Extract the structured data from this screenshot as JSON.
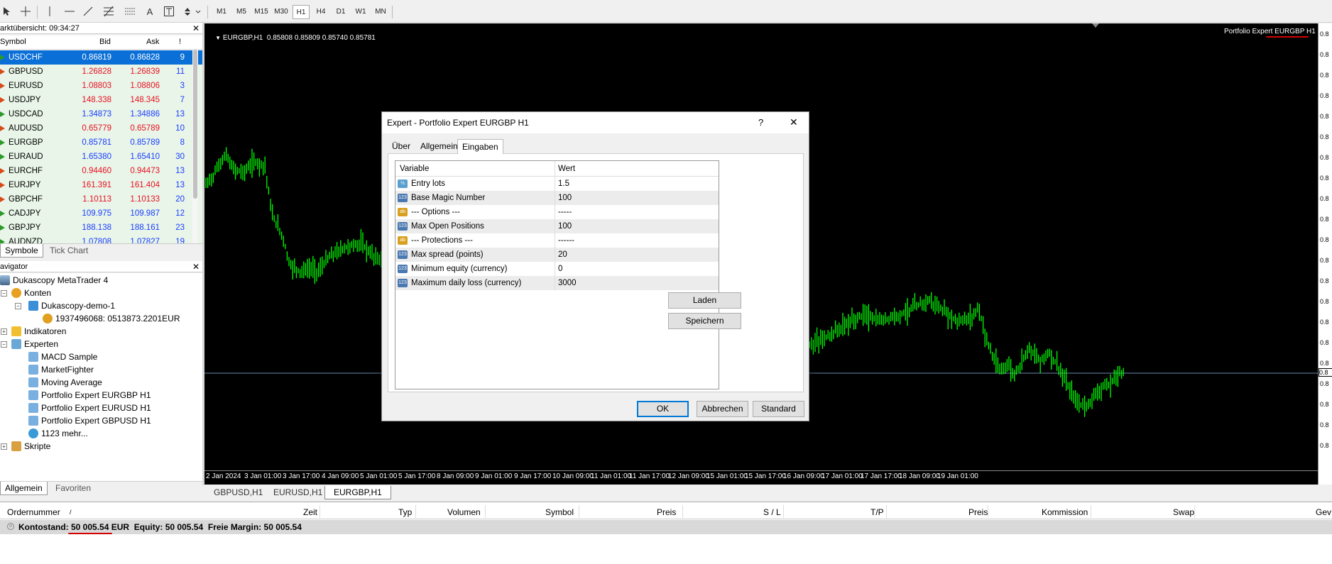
{
  "toolbar": {
    "timeframes": [
      "M1",
      "M5",
      "M15",
      "M30",
      "H1",
      "H4",
      "D1",
      "W1",
      "MN"
    ],
    "active_timeframe": "H1",
    "tools": [
      "cursor-icon",
      "crosshair-icon",
      "vertical-line-icon",
      "horizontal-line-icon",
      "trendline-icon",
      "fibonacci-icon",
      "channel-icon",
      "text-icon",
      "text-label-icon",
      "arrows-icon"
    ],
    "text_tool_label": "A"
  },
  "market_watch": {
    "title": "arktübersicht: 09:34:27",
    "columns": {
      "symbol": "Symbol",
      "bid": "Bid",
      "ask": "Ask",
      "spread": "!"
    },
    "rows": [
      {
        "symbol": "USDCHF",
        "bid": "0.86819",
        "ask": "0.86828",
        "spread": "9",
        "color": "#ffffff",
        "dir": "up"
      },
      {
        "symbol": "GBPUSD",
        "bid": "1.26828",
        "ask": "1.26839",
        "spread": "11",
        "color": "#e81123",
        "dir": "down"
      },
      {
        "symbol": "EURUSD",
        "bid": "1.08803",
        "ask": "1.08806",
        "spread": "3",
        "color": "#e81123",
        "dir": "down"
      },
      {
        "symbol": "USDJPY",
        "bid": "148.338",
        "ask": "148.345",
        "spread": "7",
        "color": "#e81123",
        "dir": "down"
      },
      {
        "symbol": "USDCAD",
        "bid": "1.34873",
        "ask": "1.34886",
        "spread": "13",
        "color": "#1a3cff",
        "dir": "up"
      },
      {
        "symbol": "AUDUSD",
        "bid": "0.65779",
        "ask": "0.65789",
        "spread": "10",
        "color": "#e81123",
        "dir": "down"
      },
      {
        "symbol": "EURGBP",
        "bid": "0.85781",
        "ask": "0.85789",
        "spread": "8",
        "color": "#1a3cff",
        "dir": "up"
      },
      {
        "symbol": "EURAUD",
        "bid": "1.65380",
        "ask": "1.65410",
        "spread": "30",
        "color": "#1a3cff",
        "dir": "up"
      },
      {
        "symbol": "EURCHF",
        "bid": "0.94460",
        "ask": "0.94473",
        "spread": "13",
        "color": "#e81123",
        "dir": "down"
      },
      {
        "symbol": "EURJPY",
        "bid": "161.391",
        "ask": "161.404",
        "spread": "13",
        "color": "#e81123",
        "dir": "down"
      },
      {
        "symbol": "GBPCHF",
        "bid": "1.10113",
        "ask": "1.10133",
        "spread": "20",
        "color": "#e81123",
        "dir": "down"
      },
      {
        "symbol": "CADJPY",
        "bid": "109.975",
        "ask": "109.987",
        "spread": "12",
        "color": "#1a3cff",
        "dir": "up"
      },
      {
        "symbol": "GBPJPY",
        "bid": "188.138",
        "ask": "188.161",
        "spread": "23",
        "color": "#1a3cff",
        "dir": "up"
      },
      {
        "symbol": "AUDNZD",
        "bid": "1.07808",
        "ask": "1.07827",
        "spread": "19",
        "color": "#1a3cff",
        "dir": "up"
      }
    ],
    "tabs": [
      "Symbole",
      "Tick Chart"
    ]
  },
  "navigator": {
    "title": "avigator",
    "root": "Dukascopy MetaTrader 4",
    "accounts_label": "Konten",
    "demo_label": "Dukascopy-demo-1",
    "account_label": "1937496068: 0513873.2201EUR",
    "indicators_label": "Indikatoren",
    "experts_label": "Experten",
    "experts": [
      "MACD Sample",
      "MarketFighter",
      "Moving Average",
      "Portfolio Expert EURGBP H1",
      "Portfolio Expert EURUSD H1",
      "Portfolio Expert GBPUSD H1",
      "1123 mehr..."
    ],
    "scripts_label": "Skripte",
    "tabs": [
      "Allgemein",
      "Favoriten"
    ]
  },
  "chart": {
    "header": "EURGBP,H1  0.85808 0.85809 0.85740 0.85781",
    "expert_label": "Portfolio Expert EURGBP H1",
    "price_line_label": "0.8",
    "scale_labels": [
      "0.8",
      "0.8",
      "0.8",
      "0.8",
      "0.8",
      "0.8",
      "0.8",
      "0.8",
      "0.8",
      "0.8",
      "0.8",
      "0.8",
      "0.8",
      "0.8",
      "0.8",
      "0.8",
      "0.8",
      "0.8",
      "0.8",
      "0.8",
      "0.8"
    ],
    "x_labels": [
      "2 Jan 2024",
      "3 Jan 01:00",
      "3 Jan 17:00",
      "4 Jan 09:00",
      "5 Jan 01:00",
      "5 Jan 17:00",
      "8 Jan 09:00",
      "9 Jan 01:00",
      "9 Jan 17:00",
      "10 Jan 09:00",
      "11 Jan 01:00",
      "11 Jan 17:00",
      "12 Jan 09:00",
      "15 Jan 01:00",
      "15 Jan 17:00",
      "16 Jan 09:00",
      "17 Jan 01:00",
      "17 Jan 17:00",
      "18 Jan 09:00",
      "19 Jan 01:00"
    ],
    "tabs": [
      "GBPUSD,H1",
      "EURUSD,H1",
      "EURGBP,H1"
    ],
    "line_color": "#00ff00",
    "accent_color": "#d40000"
  },
  "dialog": {
    "title": "Expert - Portfolio Expert EURGBP H1",
    "help_label": "?",
    "close_label": "✕",
    "tabs": [
      "Über",
      "Allgemein",
      "Eingaben"
    ],
    "table_headers": {
      "variable": "Variable",
      "value": "Wert"
    },
    "params": [
      {
        "name": "Entry lots",
        "value": "1.5",
        "icon": "double-icon",
        "icon_text": "½"
      },
      {
        "name": "Base Magic Number",
        "value": "100",
        "icon": "integer-icon",
        "icon_text": "123"
      },
      {
        "name": "--- Options ---",
        "value": "-----",
        "icon": "string-icon",
        "icon_text": "ab"
      },
      {
        "name": "Max Open Positions",
        "value": "100",
        "icon": "integer-icon",
        "icon_text": "123"
      },
      {
        "name": "--- Protections ---",
        "value": "------",
        "icon": "string-icon",
        "icon_text": "ab"
      },
      {
        "name": "Max spread (points)",
        "value": "20",
        "icon": "integer-icon",
        "icon_text": "123"
      },
      {
        "name": "Minimum equity (currency)",
        "value": "0",
        "icon": "integer-icon",
        "icon_text": "123"
      },
      {
        "name": "Maximum daily loss (currency)",
        "value": "3000",
        "icon": "integer-icon",
        "icon_text": "123"
      }
    ],
    "load_button": "Laden",
    "save_button": "Speichern",
    "ok_button": "OK",
    "cancel_button": "Abbrechen",
    "default_button": "Standard"
  },
  "terminal": {
    "columns": [
      "Ordernummer",
      "/",
      "Zeit",
      "Typ",
      "Volumen",
      "Symbol",
      "Preis",
      "S / L",
      "T/P",
      "Preis",
      "Kommission",
      "Swap",
      "Gev"
    ],
    "balance_label": "Kontostand:",
    "balance_value": "50 005.54 EUR",
    "equity_label": "Equity:",
    "equity_value": "50 005.54",
    "margin_label": "Freie Margin:",
    "margin_value": "50 005.54"
  }
}
